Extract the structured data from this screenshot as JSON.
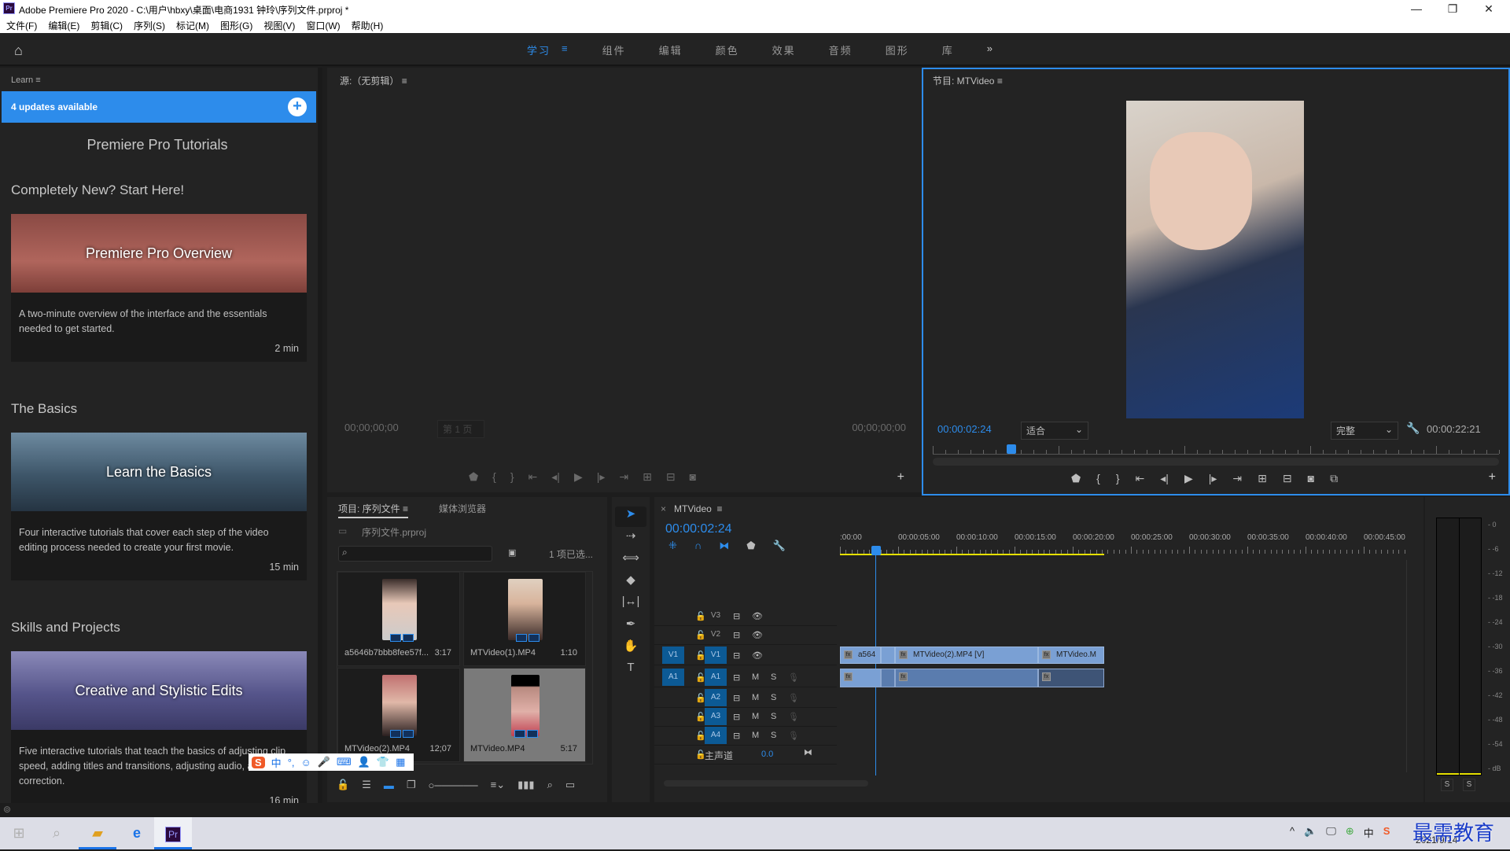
{
  "window": {
    "title": "Adobe Premiere Pro 2020 - C:\\用户\\hbxy\\桌面\\电商1931 钟玲\\序列文件.prproj *",
    "app_icon": "Pr",
    "minimize": "—",
    "restore": "❐",
    "close": "✕"
  },
  "menu": [
    "文件(F)",
    "编辑(E)",
    "剪辑(C)",
    "序列(S)",
    "标记(M)",
    "图形(G)",
    "视图(V)",
    "窗口(W)",
    "帮助(H)"
  ],
  "workspaces": {
    "tabs": [
      {
        "label": "学习",
        "active": true
      },
      {
        "label": "≡",
        "active": true
      },
      {
        "label": "组件",
        "active": false
      },
      {
        "label": "编辑",
        "active": false
      },
      {
        "label": "颜色",
        "active": false
      },
      {
        "label": "效果",
        "active": false
      },
      {
        "label": "音频",
        "active": false
      },
      {
        "label": "图形",
        "active": false
      },
      {
        "label": "库",
        "active": false
      },
      {
        "label": "»",
        "active": false
      }
    ]
  },
  "learn": {
    "header": "Learn",
    "menu_icon": "≡",
    "updates": "4 updates available",
    "title": "Premiere Pro Tutorials",
    "sections": [
      {
        "heading": "Completely New? Start Here!",
        "card_title": "Premiere Pro Overview",
        "desc": "A two-minute overview of the interface and the essentials needed to get started.",
        "duration": "2 min"
      },
      {
        "heading": "The Basics",
        "card_title": "Learn the Basics",
        "desc": "Four interactive tutorials that cover each step of the video editing process needed to create your first movie.",
        "duration": "15 min"
      },
      {
        "heading": "Skills and Projects",
        "card_title": "Creative and Stylistic Edits",
        "desc": "Five interactive tutorials that teach the basics of adjusting clip speed, adding titles and transitions, adjusting audio, and color correction.",
        "duration": "16 min"
      }
    ]
  },
  "source": {
    "header": "源:（无剪辑）",
    "timecode_in": "00;00;00;00",
    "timecode_out": "00;00;00;00",
    "page": "第 1 页"
  },
  "program": {
    "header": "节目: MTVideo",
    "timecode": "00:00:02:24",
    "fit": "适合",
    "quality": "完整",
    "duration": "00:00:22:21",
    "playhead_fraction": 0.13
  },
  "project": {
    "tab_active": "项目: 序列文件",
    "tab_other": "媒体浏览器",
    "file": "序列文件.prproj",
    "selected_count": "1 项已选...",
    "search_placeholder": "",
    "items": [
      {
        "name": "a5646b7bbb8fee57f...",
        "duration": "3:17",
        "selected": false
      },
      {
        "name": "MTVideo(1).MP4",
        "duration": "1:10",
        "selected": false
      },
      {
        "name": "MTVideo(2).MP4",
        "duration": "12;07",
        "selected": false
      },
      {
        "name": "MTVideo.MP4",
        "duration": "5:17",
        "selected": true
      }
    ]
  },
  "tools": [
    "selection-tool",
    "track-select-tool",
    "ripple-edit-tool",
    "razor-tool",
    "slip-tool",
    "pen-tool",
    "hand-tool",
    "type-tool"
  ],
  "timeline": {
    "sequence": "MTVideo",
    "timecode": "00:00:02:24",
    "ruler": [
      ":00:00",
      "00:00:05:00",
      "00:00:10:00",
      "00:00:15:00",
      "00:00:20:00",
      "00:00:25:00",
      "00:00:30:00",
      "00:00:35:00",
      "00:00:40:00",
      "00:00:45:00"
    ],
    "video_tracks": [
      "V3",
      "V2",
      "V1"
    ],
    "audio_tracks": [
      "A1",
      "A2",
      "A3",
      "A4"
    ],
    "source_patch_v": "V1",
    "source_patch_a": "A1",
    "mute": "M",
    "solo": "S",
    "master_label": "主声道",
    "master_value": "0.0",
    "clips": [
      {
        "name": "a564",
        "track": "V1"
      },
      {
        "name": "MTVideo(2).MP4 [V]",
        "track": "V1"
      },
      {
        "name": "MTVideo.M",
        "track": "V1"
      }
    ]
  },
  "meter": {
    "scale": [
      "0",
      "-6",
      "-12",
      "-18",
      "-24",
      "-30",
      "-36",
      "-42",
      "-48",
      "-54",
      "dB"
    ],
    "solo_left": "S",
    "solo_right": "S"
  },
  "taskbar": {
    "date": "2021/9/14",
    "watermark": "最需教育",
    "ime": "中"
  }
}
